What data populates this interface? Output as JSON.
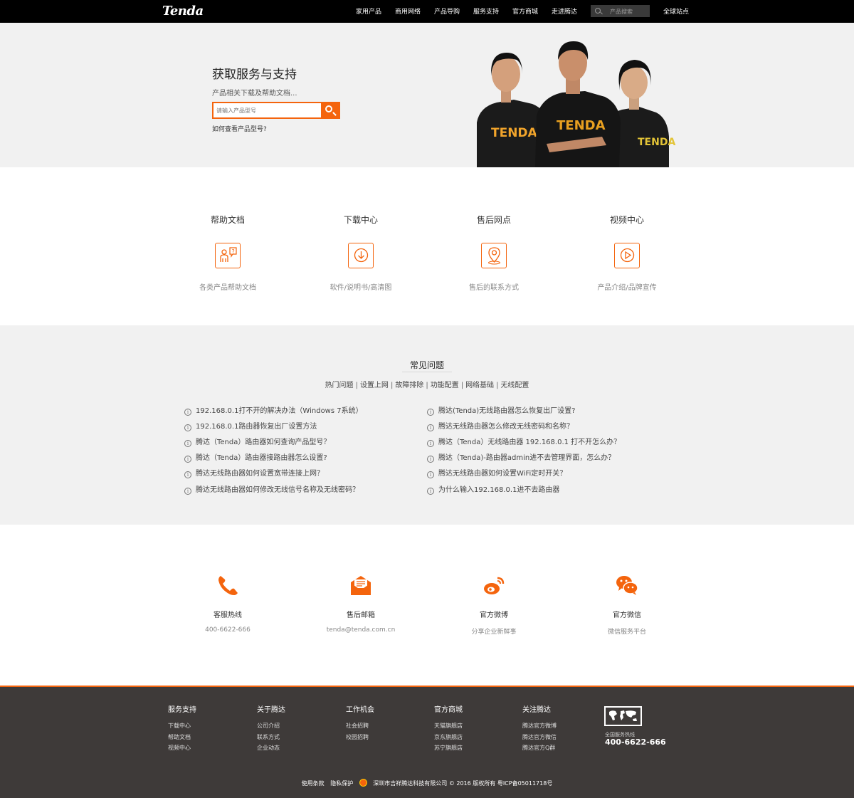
{
  "brand": {
    "logo_text": "Tenda",
    "accent_color": "#f4640d",
    "dark_color": "#000000",
    "footer_bg": "#3e3a39"
  },
  "nav": {
    "items": [
      "家用产品",
      "商用网络",
      "产品导购",
      "服务支持",
      "官方商城",
      "走进腾达"
    ],
    "search_placeholder": "产品搜索",
    "global_sites": "全球站点"
  },
  "hero": {
    "title": "获取服务与支持",
    "subtitle": "产品相关下载及帮助文档...",
    "search_placeholder": "请输入产品型号",
    "help_link": "如何查看产品型号?",
    "shirt_text": "TENDA"
  },
  "services": [
    {
      "title": "帮助文档",
      "subtitle": "各类产品帮助文档",
      "icon": "help-doc-icon"
    },
    {
      "title": "下载中心",
      "subtitle": "软件/说明书/高清图",
      "icon": "download-icon"
    },
    {
      "title": "售后网点",
      "subtitle": "售后的联系方式",
      "icon": "location-pin-icon"
    },
    {
      "title": "视频中心",
      "subtitle": "产品介绍/品牌宣传",
      "icon": "play-video-icon"
    }
  ],
  "faq": {
    "title": "常见问题",
    "tabs": [
      "热门问题",
      "设置上网",
      "故障排除",
      "功能配置",
      "网络基础",
      "无线配置"
    ],
    "left": [
      "192.168.0.1打不开的解决办法（Windows 7系统）",
      "192.168.0.1路由器恢复出厂设置方法",
      "腾达（Tenda）路由器如何查询产品型号？",
      "腾达（Tenda）路由器接路由器怎么设置?",
      "腾达无线路由器如何设置宽带连接上网？",
      "腾达无线路由器如何修改无线信号名称及无线密码？"
    ],
    "right": [
      "腾达(Tenda)无线路由器怎么恢复出厂设置?",
      "腾达无线路由器怎么修改无线密码和名称？",
      "腾达（Tenda）无线路由器 192.168.0.1 打不开怎么办？",
      "腾达（Tenda)-路由器admin进不去管理界面，怎么办？",
      "腾达无线路由器如何设置WiFi定时开关？",
      "为什么输入192.168.0.1进不去路由器"
    ]
  },
  "contact": [
    {
      "title": "客服热线",
      "subtitle": "400-6622-666",
      "icon": "phone-icon"
    },
    {
      "title": "售后邮箱",
      "subtitle": "tenda@tenda.com.cn",
      "icon": "mail-icon"
    },
    {
      "title": "官方微博",
      "subtitle": "分享企业新鲜事",
      "icon": "weibo-icon"
    },
    {
      "title": "官方微信",
      "subtitle": "微信服务平台",
      "icon": "wechat-icon"
    }
  ],
  "footer": {
    "columns": [
      {
        "head": "服务支持",
        "links": [
          "下载中心",
          "帮助文档",
          "视频中心"
        ]
      },
      {
        "head": "关于腾达",
        "links": [
          "公司介绍",
          "联系方式",
          "企业动态"
        ]
      },
      {
        "head": "工作机会",
        "links": [
          "社会招聘",
          "校园招聘"
        ]
      },
      {
        "head": "官方商城",
        "links": [
          "天猫旗舰店",
          "京东旗舰店",
          "苏宁旗舰店"
        ]
      },
      {
        "head": "关注腾达",
        "links": [
          "腾达官方微博",
          "腾达官方微信",
          "腾达官方Q群"
        ]
      }
    ],
    "hotline_label": "全国服务热线",
    "hotline": "400-6622-666",
    "terms": "使用条款",
    "privacy": "隐私保护",
    "copyright": "深圳市吉祥腾达科技有限公司 © 2016 版权所有 粤ICP备05011718号"
  }
}
